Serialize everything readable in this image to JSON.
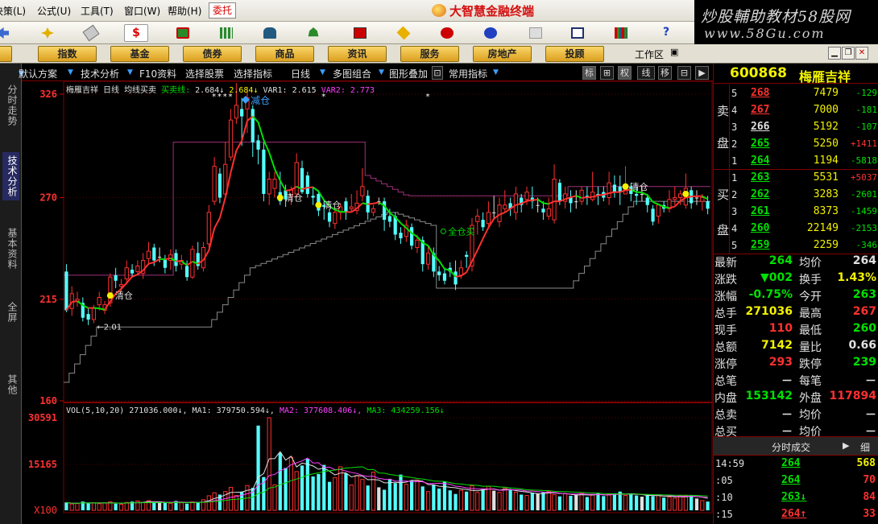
{
  "menu": {
    "items": [
      "决策(L)",
      "公式(U)",
      "工具(T)",
      "窗口(W)",
      "帮助(H)"
    ],
    "active": "委托",
    "title": "大智慧金融终端"
  },
  "watermark": {
    "line1": "炒股輔助教材58股网",
    "line2": "www.58Gu.com"
  },
  "toolbar": {
    "icons": [
      "back-icon",
      "move-icon",
      "ruler-icon",
      "dollar-icon",
      "money-icon",
      "grid-icon",
      "binoculars-icon",
      "alarm-icon",
      "info-icon",
      "diamond-icon",
      "pen-icon",
      "clock-icon",
      "printer-icon",
      "window-icon",
      "bar-chart-icon",
      "help-icon"
    ]
  },
  "categories": [
    "股",
    "指数",
    "基金",
    "债券",
    "商品",
    "资讯",
    "服务",
    "房地产",
    "投顾"
  ],
  "workarea": "工作区",
  "vtabs": [
    "分时走势",
    "技术分析",
    "基本资料",
    "全屏",
    "其他"
  ],
  "chart_toolbar": {
    "items": [
      "默认方案",
      "技术分析",
      "F10资料",
      "选择股票",
      "选择指标",
      "日线",
      "多图组合",
      "图形叠加",
      "常用指标"
    ],
    "buttons": [
      "标",
      "⊞",
      "权",
      "线",
      "移",
      "⊟",
      "▶"
    ]
  },
  "chart_legend": {
    "name": "梅雁吉祥",
    "period": "日线",
    "indicator": "均线买卖",
    "main_label": "买卖线:",
    "main_value": "2.684↓",
    "second_value": "2.684↓",
    "var1": "VAR1: 2.615",
    "var2": "VAR2: 2.773"
  },
  "vol_legend": {
    "vol": "VOL(5,10,20) 271036.000↓,",
    "ma1": "MA1: 379750.594↓,",
    "ma2": "MA2: 377608.406↓,",
    "ma3": "MA3: 434259.156↓"
  },
  "annotations": {
    "reduce": "减仓",
    "clear": "清仓",
    "buy_all": "全仓买",
    "low_mark": "←2.01"
  },
  "colors": {
    "up": "#ff3030",
    "down": "#54ffff",
    "flat": "#e0e0e0",
    "yellow": "#f2f200",
    "green": "#00e000",
    "magenta": "#ff40ff",
    "frame": "#800000"
  },
  "stock": {
    "code": "600868",
    "name": "梅雁吉祥"
  },
  "orderbook": {
    "sell_label": "卖盘",
    "buy_label": "买盘",
    "sell": [
      {
        "lvl": "5",
        "price": "268",
        "vol": "7479",
        "chg": "-129"
      },
      {
        "lvl": "4",
        "price": "267",
        "vol": "7000",
        "chg": "-181"
      },
      {
        "lvl": "3",
        "price": "266",
        "vol": "5192",
        "chg": "-107"
      },
      {
        "lvl": "2",
        "price": "265",
        "vol": "5250",
        "chg": "+1411"
      },
      {
        "lvl": "1",
        "price": "264",
        "vol": "1194",
        "chg": "-5818"
      }
    ],
    "buy": [
      {
        "lvl": "1",
        "price": "263",
        "vol": "5531",
        "chg": "+5037"
      },
      {
        "lvl": "2",
        "price": "262",
        "vol": "3283",
        "chg": "-2601"
      },
      {
        "lvl": "3",
        "price": "261",
        "vol": "8373",
        "chg": "-1459"
      },
      {
        "lvl": "4",
        "price": "260",
        "vol": "22149",
        "chg": "-2153"
      },
      {
        "lvl": "5",
        "price": "259",
        "vol": "2259",
        "chg": "-346"
      }
    ]
  },
  "quote": [
    {
      "l1": "最新",
      "v1": "264",
      "l2": "均价",
      "v2": "264"
    },
    {
      "l1": "涨跌",
      "v1": "▼002",
      "l2": "换手",
      "v2": "1.43%"
    },
    {
      "l1": "涨幅",
      "v1": "-0.75%",
      "l2": "今开",
      "v2": "263"
    },
    {
      "l1": "总手",
      "v1": "271036",
      "l2": "最高",
      "v2": "267"
    },
    {
      "l1": "现手",
      "v1": "110",
      "l2": "最低",
      "v2": "260"
    },
    {
      "l1": "总额",
      "v1": "7142",
      "l2": "量比",
      "v2": "0.66"
    },
    {
      "l1": "涨停",
      "v1": "293",
      "l2": "跌停",
      "v2": "239"
    },
    {
      "l1": "总笔",
      "v1": "－",
      "l2": "每笔",
      "v2": "－"
    },
    {
      "l1": "内盘",
      "v1": "153142",
      "l2": "外盘",
      "v2": "117894"
    },
    {
      "l1": "总卖",
      "v1": "－",
      "l2": "均价",
      "v2": "－"
    },
    {
      "l1": "总买",
      "v1": "－",
      "l2": "均价",
      "v2": "－"
    }
  ],
  "trades": {
    "title": "分时成交",
    "detail": "细",
    "rows": [
      {
        "time": "14:59",
        "price": "264",
        "vol": "568"
      },
      {
        "time": ":05",
        "price": "264",
        "vol": "70"
      },
      {
        "time": ":10",
        "price": "263↓",
        "vol": "84"
      },
      {
        "time": ":15",
        "price": "264↑",
        "vol": "33"
      }
    ]
  },
  "chart_data": {
    "type": "candlestick",
    "price_axis_ticks": [
      "326",
      "270",
      "215",
      "160"
    ],
    "price_ylim": [
      160,
      326
    ],
    "volume_axis_ticks": [
      "30591",
      "15165",
      "X100"
    ],
    "volume_ylim": [
      0,
      30591
    ],
    "candles": [
      [
        230,
        209,
        234,
        208
      ],
      [
        210,
        218,
        222,
        206
      ],
      [
        214,
        215,
        219,
        211
      ],
      [
        213,
        205,
        216,
        203
      ],
      [
        207,
        204,
        210,
        201
      ],
      [
        204,
        210,
        212,
        202
      ],
      [
        212,
        216,
        219,
        209
      ],
      [
        209,
        212,
        214,
        207
      ],
      [
        213,
        227,
        229,
        211
      ],
      [
        228,
        225,
        232,
        221
      ],
      [
        222,
        223,
        226,
        219
      ],
      [
        226,
        232,
        236,
        223
      ],
      [
        231,
        229,
        234,
        227
      ],
      [
        230,
        233,
        236,
        228
      ],
      [
        229,
        236,
        240,
        226
      ],
      [
        237,
        241,
        246,
        234
      ],
      [
        243,
        236,
        245,
        233
      ],
      [
        238,
        238,
        243,
        235
      ],
      [
        237,
        232,
        239,
        229
      ],
      [
        236,
        239,
        242,
        231
      ],
      [
        240,
        233,
        242,
        230
      ],
      [
        234,
        236,
        239,
        231
      ],
      [
        233,
        227,
        236,
        225
      ],
      [
        227,
        242,
        244,
        226
      ],
      [
        240,
        233,
        246,
        231
      ],
      [
        232,
        243,
        246,
        230
      ],
      [
        245,
        262,
        266,
        243
      ],
      [
        268,
        287,
        292,
        266
      ],
      [
        283,
        270,
        286,
        267
      ],
      [
        272,
        288,
        300,
        270
      ],
      [
        292,
        312,
        318,
        290
      ],
      [
        313,
        320,
        332,
        310
      ],
      [
        318,
        314,
        324,
        298
      ],
      [
        318,
        324,
        330,
        305
      ],
      [
        318,
        300,
        320,
        292
      ],
      [
        301,
        296,
        304,
        288
      ],
      [
        296,
        272,
        300,
        268
      ],
      [
        272,
        280,
        284,
        266
      ],
      [
        275,
        280,
        284,
        270
      ],
      [
        273,
        268,
        284,
        266
      ],
      [
        274,
        269,
        277,
        265
      ],
      [
        271,
        274,
        276,
        266
      ],
      [
        272,
        289,
        294,
        270
      ],
      [
        286,
        273,
        290,
        272
      ],
      [
        282,
        272,
        284,
        270
      ],
      [
        271,
        270,
        276,
        266
      ],
      [
        272,
        263,
        274,
        260
      ],
      [
        266,
        265,
        269,
        258
      ],
      [
        262,
        257,
        264,
        254
      ],
      [
        256,
        262,
        264,
        253
      ],
      [
        262,
        265,
        267,
        258
      ],
      [
        268,
        262,
        270,
        258
      ],
      [
        264,
        265,
        272,
        262
      ],
      [
        263,
        267,
        274,
        261
      ],
      [
        271,
        276,
        286,
        268
      ],
      [
        271,
        262,
        274,
        258
      ],
      [
        262,
        264,
        266,
        260
      ],
      [
        268,
        268,
        270,
        266
      ],
      [
        268,
        258,
        270,
        252
      ],
      [
        260,
        257,
        264,
        254
      ],
      [
        260,
        250,
        262,
        247
      ],
      [
        251,
        248,
        254,
        245
      ],
      [
        249,
        255,
        258,
        246
      ],
      [
        254,
        244,
        256,
        242
      ],
      [
        243,
        247,
        250,
        240
      ],
      [
        247,
        234,
        249,
        230
      ],
      [
        234,
        240,
        244,
        231
      ],
      [
        240,
        230,
        243,
        227
      ],
      [
        230,
        228,
        233,
        225
      ],
      [
        229,
        225,
        232,
        223
      ],
      [
        232,
        230,
        235,
        227
      ],
      [
        230,
        223,
        236,
        220
      ],
      [
        228,
        232,
        236,
        226
      ],
      [
        239,
        238,
        241,
        232
      ],
      [
        233,
        255,
        259,
        230
      ],
      [
        257,
        260,
        264,
        250
      ],
      [
        258,
        254,
        262,
        252
      ],
      [
        256,
        262,
        268,
        254
      ],
      [
        262,
        262,
        271,
        258
      ],
      [
        257,
        266,
        270,
        254
      ],
      [
        264,
        266,
        274,
        262
      ],
      [
        267,
        264,
        270,
        260
      ],
      [
        262,
        272,
        276,
        258
      ],
      [
        270,
        266,
        272,
        262
      ],
      [
        269,
        273,
        276,
        266
      ],
      [
        270,
        268,
        276,
        264
      ],
      [
        266,
        266,
        270,
        262
      ],
      [
        264,
        262,
        268,
        258
      ],
      [
        260,
        264,
        270,
        258
      ],
      [
        258,
        280,
        288,
        256
      ],
      [
        278,
        268,
        280,
        266
      ],
      [
        268,
        272,
        276,
        264
      ],
      [
        270,
        267,
        274,
        262
      ],
      [
        268,
        268,
        274,
        264
      ],
      [
        268,
        274,
        276,
        266
      ],
      [
        271,
        270,
        276,
        266
      ],
      [
        269,
        273,
        284,
        268
      ],
      [
        272,
        271,
        276,
        266
      ],
      [
        273,
        270,
        276,
        268
      ],
      [
        270,
        278,
        284,
        266
      ],
      [
        277,
        273,
        282,
        270
      ],
      [
        276,
        273,
        282,
        266
      ],
      [
        272,
        276,
        287,
        272
      ],
      [
        276,
        272,
        278,
        268
      ],
      [
        272,
        271,
        276,
        266
      ],
      [
        272,
        272,
        276,
        268
      ],
      [
        270,
        266,
        272,
        262
      ],
      [
        264,
        257,
        266,
        255
      ],
      [
        260,
        266,
        266,
        256
      ],
      [
        266,
        264,
        268,
        262
      ],
      [
        264,
        269,
        274,
        262
      ],
      [
        269,
        270,
        276,
        266
      ],
      [
        270,
        272,
        274,
        266
      ],
      [
        266,
        275,
        283,
        264
      ],
      [
        274,
        267,
        276,
        264
      ],
      [
        270,
        270,
        274,
        266
      ],
      [
        268,
        270,
        272,
        263
      ],
      [
        268,
        264,
        271,
        261
      ]
    ],
    "volumes": [
      2600,
      2100,
      2300,
      2900,
      2300,
      2500,
      2200,
      2400,
      2800,
      2200,
      2000,
      2600,
      2900,
      3100,
      2600,
      3200,
      2400,
      2800,
      2500,
      2300,
      3100,
      2500,
      2200,
      2800,
      2600,
      3500,
      4800,
      5800,
      5200,
      6200,
      7600,
      4900,
      6200,
      8200,
      7400,
      28000,
      11000,
      30591,
      8400,
      19000,
      14000,
      17500,
      12800,
      14800,
      17000,
      11200,
      12000,
      15000,
      9400,
      10800,
      14400,
      12200,
      8400,
      11500,
      10200,
      8200,
      12600,
      7600,
      6800,
      10400,
      9000,
      11800,
      8600,
      9800,
      10000,
      7900,
      6200,
      8400,
      7200,
      9600,
      6600,
      5400,
      6600,
      6200,
      8100,
      5900,
      7000,
      7900,
      6500,
      5900,
      7400,
      6800,
      6000,
      5200,
      4900,
      5800,
      5600,
      6100,
      6300,
      5200,
      4600,
      5500,
      4800,
      5200,
      5600,
      4400,
      5200,
      5800,
      4700,
      5300,
      5600,
      6200,
      4900,
      5400,
      4900,
      4500,
      5000,
      4700,
      5100,
      4200,
      4400,
      4000,
      4800,
      4900,
      5000,
      3900,
      3200,
      2900
    ]
  }
}
